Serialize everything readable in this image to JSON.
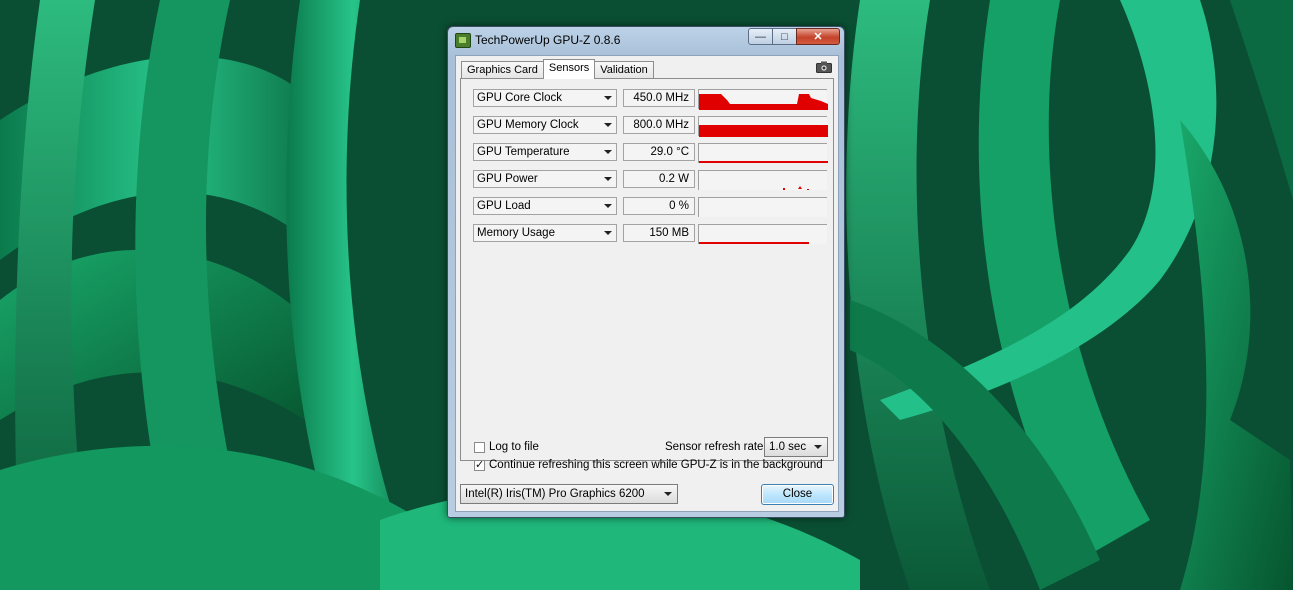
{
  "window": {
    "title": "TechPowerUp GPU-Z 0.8.6"
  },
  "caption_buttons": {
    "minimize": "—",
    "maximize": "□",
    "close": "✕"
  },
  "tabs": [
    {
      "label": "Graphics Card"
    },
    {
      "label": "Sensors",
      "active": true
    },
    {
      "label": "Validation"
    }
  ],
  "sensors": [
    {
      "label": "GPU Core Clock",
      "value": "450.0 MHz"
    },
    {
      "label": "GPU Memory Clock",
      "value": "800.0 MHz"
    },
    {
      "label": "GPU Temperature",
      "value": "29.0 °C"
    },
    {
      "label": "GPU Power",
      "value": "0.2 W"
    },
    {
      "label": "GPU Load",
      "value": "0 %"
    },
    {
      "label": "Memory Usage",
      "value": "150 MB"
    }
  ],
  "options": {
    "log_to_file": {
      "label": "Log to file",
      "checked": false
    },
    "continue_refreshing": {
      "label": "Continue refreshing this screen while GPU-Z is in the background",
      "checked": true
    },
    "refresh_rate_label": "Sensor refresh rate:",
    "refresh_rate_value": "1.0 sec"
  },
  "footer": {
    "gpu_select": "Intel(R) Iris(TM) Pro Graphics 6200",
    "close_label": "Close"
  },
  "colors": {
    "graph": "#e00000",
    "accent": "#3c7fb1"
  }
}
